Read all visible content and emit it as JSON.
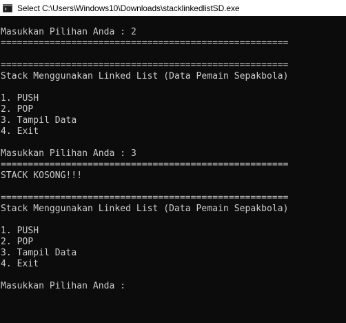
{
  "window": {
    "title": "Select C:\\Users\\Windows10\\Downloads\\stacklinkedlistSD.exe",
    "icon": "console-app-icon"
  },
  "console": {
    "lines": [
      "Masukkan Pilihan Anda : 2",
      "=====================================================",
      "",
      "=====================================================",
      "Stack Menggunakan Linked List (Data Pemain Sepakbola)",
      "",
      "1. PUSH",
      "2. POP",
      "3. Tampil Data",
      "4. Exit",
      "",
      "Masukkan Pilihan Anda : 3",
      "=====================================================",
      "STACK KOSONG!!!",
      "",
      "=====================================================",
      "Stack Menggunakan Linked List (Data Pemain Sepakbola)",
      "",
      "1. PUSH",
      "2. POP",
      "3. Tampil Data",
      "4. Exit",
      "",
      "Masukkan Pilihan Anda : "
    ]
  },
  "colors": {
    "background": "#0c0c0c",
    "text": "#cccccc",
    "titlebar": "#ffffff"
  }
}
